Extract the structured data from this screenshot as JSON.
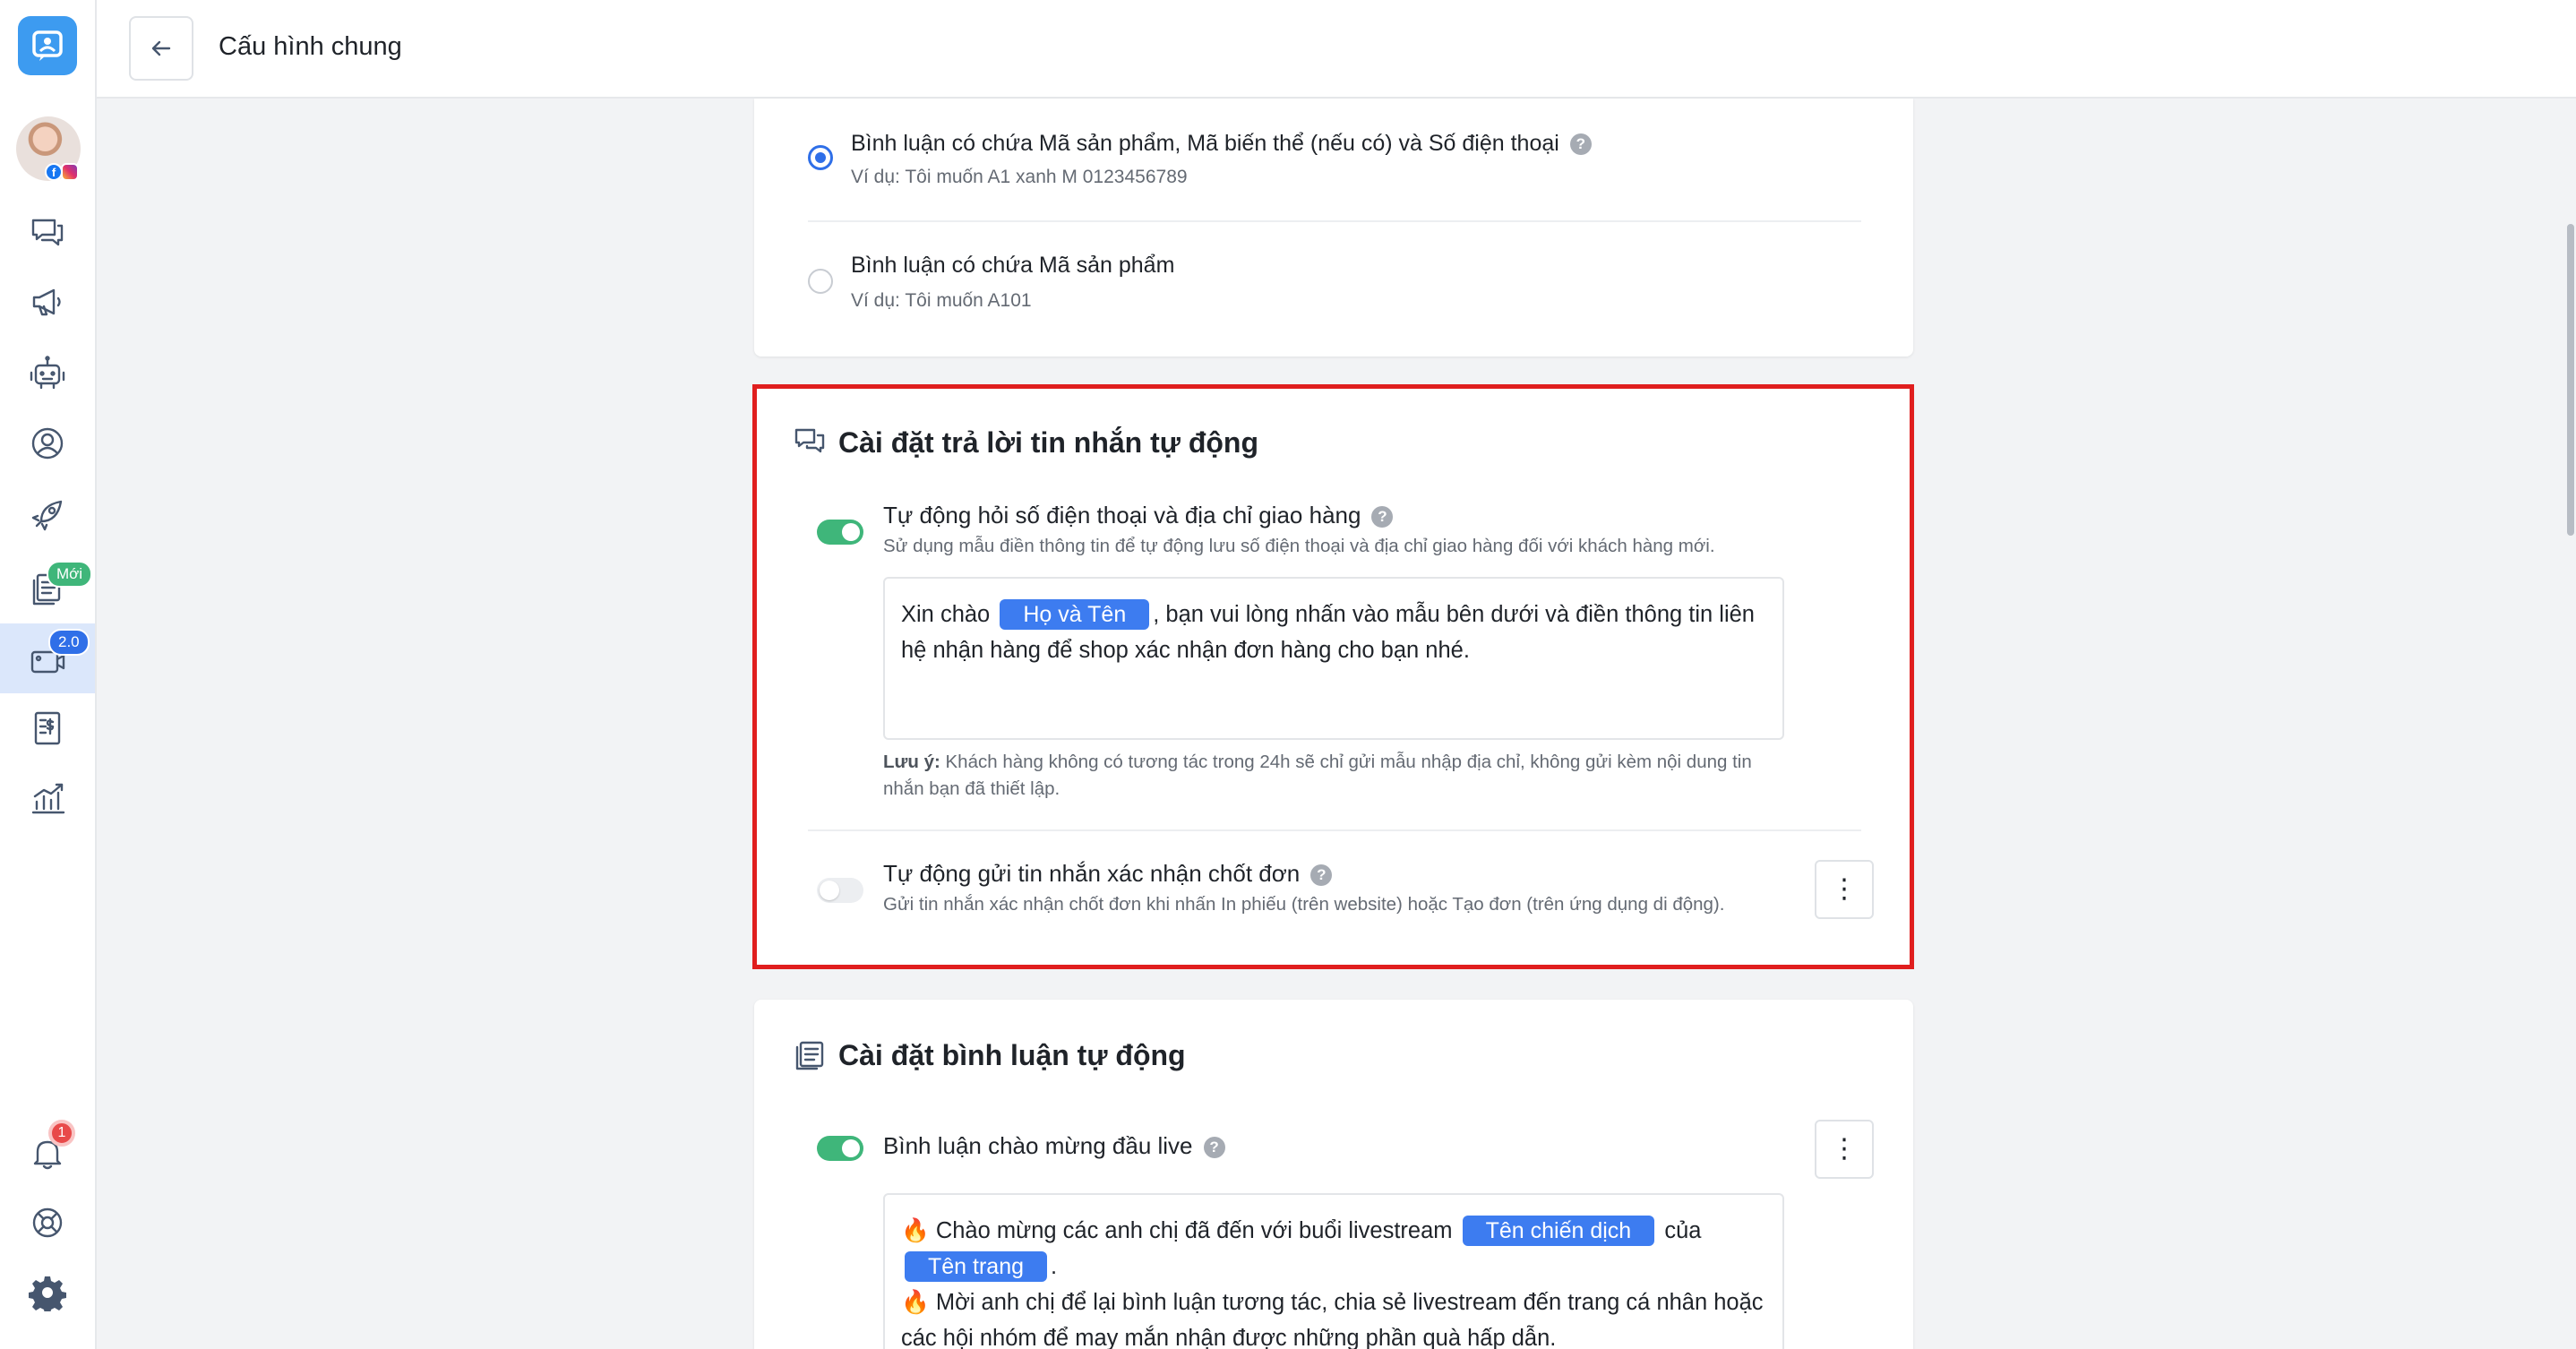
{
  "header": {
    "title": "Cấu hình chung"
  },
  "sidebar": {
    "badges": {
      "new": "Mới",
      "version": "2.0",
      "notifications": "1"
    },
    "icons": [
      "chat-icon",
      "megaphone-icon",
      "robot-icon",
      "user-circle-icon",
      "rocket-icon",
      "document-new-icon",
      "livestream-icon",
      "invoice-icon",
      "analytics-icon",
      "bell-icon",
      "support-icon",
      "settings-icon"
    ]
  },
  "comment_parse": {
    "options": [
      {
        "title": "Bình luận có chứa Mã sản phẩm, Mã biến thể (nếu có) và Số điện thoại",
        "example": "Ví dụ: Tôi muốn A1 xanh M 0123456789",
        "selected": true
      },
      {
        "title": "Bình luận có chứa Mã sản phẩm",
        "example": "Ví dụ: Tôi muốn A101",
        "selected": false
      }
    ]
  },
  "auto_reply": {
    "title": "Cài đặt trả lời tin nhắn tự động",
    "ask_info": {
      "title": "Tự động hỏi số điện thoại và địa chỉ giao hàng",
      "description": "Sử dụng mẫu điền thông tin để tự động lưu số điện thoại và địa chỉ giao hàng đối với khách hàng mới.",
      "enabled": true,
      "message_prefix": "Xin chào",
      "message_tag": "Họ và Tên",
      "message_suffix": ", bạn vui lòng nhấn vào mẫu bên dưới và điền thông tin liên hệ nhận hàng để shop xác nhận đơn hàng cho bạn nhé.",
      "note_label": "Lưu ý:",
      "note_text": " Khách hàng không có tương tác trong 24h sẽ chỉ gửi mẫu nhập địa chỉ, không gửi kèm nội dung tin nhắn bạn đã thiết lập."
    },
    "confirm_order": {
      "title": "Tự động gửi tin nhắn xác nhận chốt đơn",
      "description": "Gửi tin nhắn xác nhận chốt đơn khi nhấn In phiếu (trên website) hoặc Tạo đơn (trên ứng dụng di động).",
      "enabled": false
    }
  },
  "auto_comment": {
    "title": "Cài đặt bình luận tự động",
    "welcome": {
      "title": "Bình luận chào mừng đầu live",
      "enabled": true,
      "line1_prefix": "🔥 Chào mừng các anh chị đã đến với buổi livestream",
      "tag_campaign": "Tên chiến dịch",
      "line1_mid": "của",
      "tag_page": "Tên trang",
      "line1_end": ".",
      "line2": "🔥 Mời anh chị để lại bình luận tương tác, chia sẻ livestream đến trang cá nhân hoặc các hội nhóm để may mắn nhận được những phần quà hấp dẫn."
    }
  },
  "colors": {
    "accent": "#2f6fe8",
    "toggle_on": "#3fb67a",
    "highlight": "#e01e1e",
    "tag": "#3d7cf0"
  }
}
